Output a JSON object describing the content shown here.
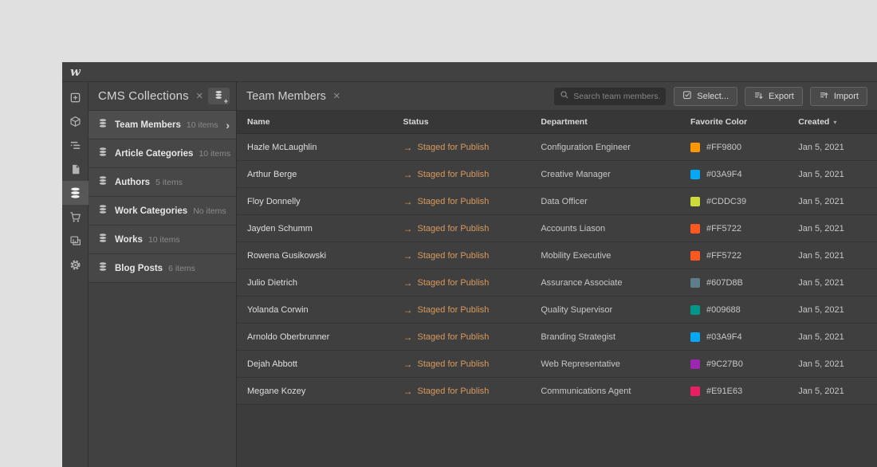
{
  "window": {
    "logo": "w"
  },
  "toolbar": {
    "items": [
      {
        "label": "add-elements",
        "icon": "plus-square-icon",
        "active": false
      },
      {
        "label": "symbols",
        "icon": "cube-icon",
        "active": false
      },
      {
        "label": "navigator",
        "icon": "navigator-icon",
        "active": false
      },
      {
        "label": "pages",
        "icon": "page-icon",
        "active": false
      },
      {
        "label": "cms-collections",
        "icon": "database-icon",
        "active": true
      },
      {
        "label": "ecommerce",
        "icon": "cart-icon",
        "active": false
      },
      {
        "label": "assets",
        "icon": "images-icon",
        "active": false
      },
      {
        "label": "settings",
        "icon": "gear-icon",
        "active": false
      }
    ]
  },
  "panel": {
    "title": "CMS Collections",
    "close_glyph": "×",
    "chevron_glyph": "›",
    "add_button_glyph": "+",
    "collections": [
      {
        "label": "Team Members",
        "count": "10 items",
        "selected": true
      },
      {
        "label": "Article Categories",
        "count": "10 items",
        "selected": false
      },
      {
        "label": "Authors",
        "count": "5 items",
        "selected": false
      },
      {
        "label": "Work Categories",
        "count": "No items",
        "selected": false
      },
      {
        "label": "Works",
        "count": "10 items",
        "selected": false
      },
      {
        "label": "Blog Posts",
        "count": "6 items",
        "selected": false
      }
    ]
  },
  "main": {
    "title": "Team Members",
    "close_glyph": "×",
    "search": {
      "placeholder": "Search team members..."
    },
    "actions": {
      "select": "Select...",
      "export": "Export",
      "import": "Import"
    },
    "table": {
      "columns": {
        "name": "Name",
        "status": "Status",
        "department": "Department",
        "favorite_color": "Favorite Color",
        "created": "Created"
      },
      "sort_glyph": "▾",
      "status_arrow_glyph": "→",
      "rows": [
        {
          "name": "Hazle McLaughlin",
          "status": "Staged for Publish",
          "department": "Configuration Engineer",
          "color": "#FF9800",
          "created": "Jan 5, 2021"
        },
        {
          "name": "Arthur Berge",
          "status": "Staged for Publish",
          "department": "Creative Manager",
          "color": "#03A9F4",
          "created": "Jan 5, 2021"
        },
        {
          "name": "Floy Donnelly",
          "status": "Staged for Publish",
          "department": "Data Officer",
          "color": "#CDDC39",
          "created": "Jan 5, 2021"
        },
        {
          "name": "Jayden Schumm",
          "status": "Staged for Publish",
          "department": "Accounts Liason",
          "color": "#FF5722",
          "created": "Jan 5, 2021"
        },
        {
          "name": "Rowena Gusikowski",
          "status": "Staged for Publish",
          "department": "Mobility Executive",
          "color": "#FF5722",
          "created": "Jan 5, 2021"
        },
        {
          "name": "Julio Dietrich",
          "status": "Staged for Publish",
          "department": "Assurance Associate",
          "color": "#607D8B",
          "created": "Jan 5, 2021"
        },
        {
          "name": "Yolanda Corwin",
          "status": "Staged for Publish",
          "department": "Quality Supervisor",
          "color": "#009688",
          "created": "Jan 5, 2021"
        },
        {
          "name": "Arnoldo Oberbrunner",
          "status": "Staged for Publish",
          "department": "Branding Strategist",
          "color": "#03A9F4",
          "created": "Jan 5, 2021"
        },
        {
          "name": "Dejah Abbott",
          "status": "Staged for Publish",
          "department": "Web Representative",
          "color": "#9C27B0",
          "created": "Jan 5, 2021"
        },
        {
          "name": "Megane Kozey",
          "status": "Staged for Publish",
          "department": "Communications Agent",
          "color": "#E91E63",
          "created": "Jan 5, 2021"
        }
      ]
    }
  },
  "colors": {
    "status_text": "#D89A5E"
  }
}
